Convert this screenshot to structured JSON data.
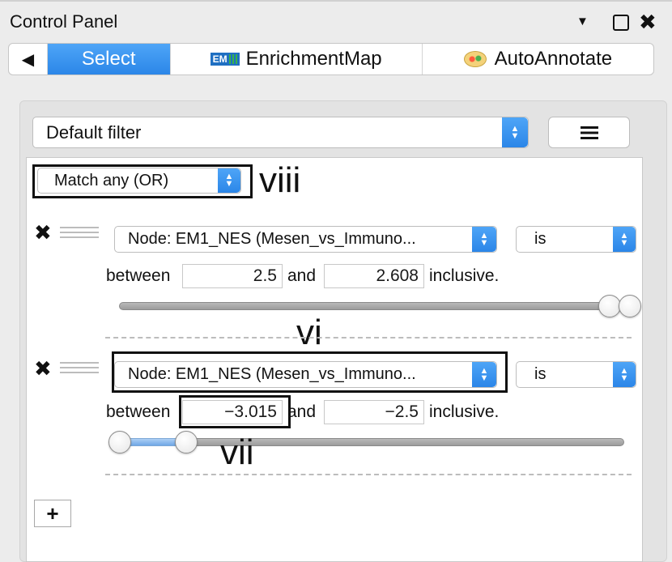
{
  "window": {
    "title": "Control Panel",
    "min_icon": "▼",
    "close_icon": "✖"
  },
  "tabs": {
    "back": "◀",
    "items": [
      {
        "label": "Select",
        "active": true
      },
      {
        "label": "EnrichmentMap",
        "icon": "enrichmentmap-icon",
        "icon_text": "EM"
      },
      {
        "label": "AutoAnnotate",
        "icon": "autoannotate-icon"
      }
    ]
  },
  "filter": {
    "preset": "Default filter",
    "menu_icon": "hamburger-icon",
    "match_mode": "Match any (OR)",
    "rules": [
      {
        "column": "Node: EM1_NES (Mesen_vs_Immuno...",
        "operator": "is",
        "between_label": "between",
        "low": "2.5",
        "and_label": "and",
        "high": "2.608",
        "inclusive_label": "inclusive.",
        "range_low_fraction": 0.96,
        "range_high_fraction": 1.0
      },
      {
        "column": "Node: EM1_NES (Mesen_vs_Immuno...",
        "operator": "is",
        "between_label": "between",
        "low": "−3.015",
        "and_label": "and",
        "high": "−2.5",
        "inclusive_label": "inclusive.",
        "range_low_fraction": 0.0,
        "range_high_fraction": 0.13
      }
    ],
    "add_label": "+"
  },
  "annotations": {
    "viii": "viii",
    "vi": "vi",
    "vii": "vii"
  },
  "colors": {
    "accent": "#2b86e8",
    "accent_light": "#4ea5f7"
  }
}
